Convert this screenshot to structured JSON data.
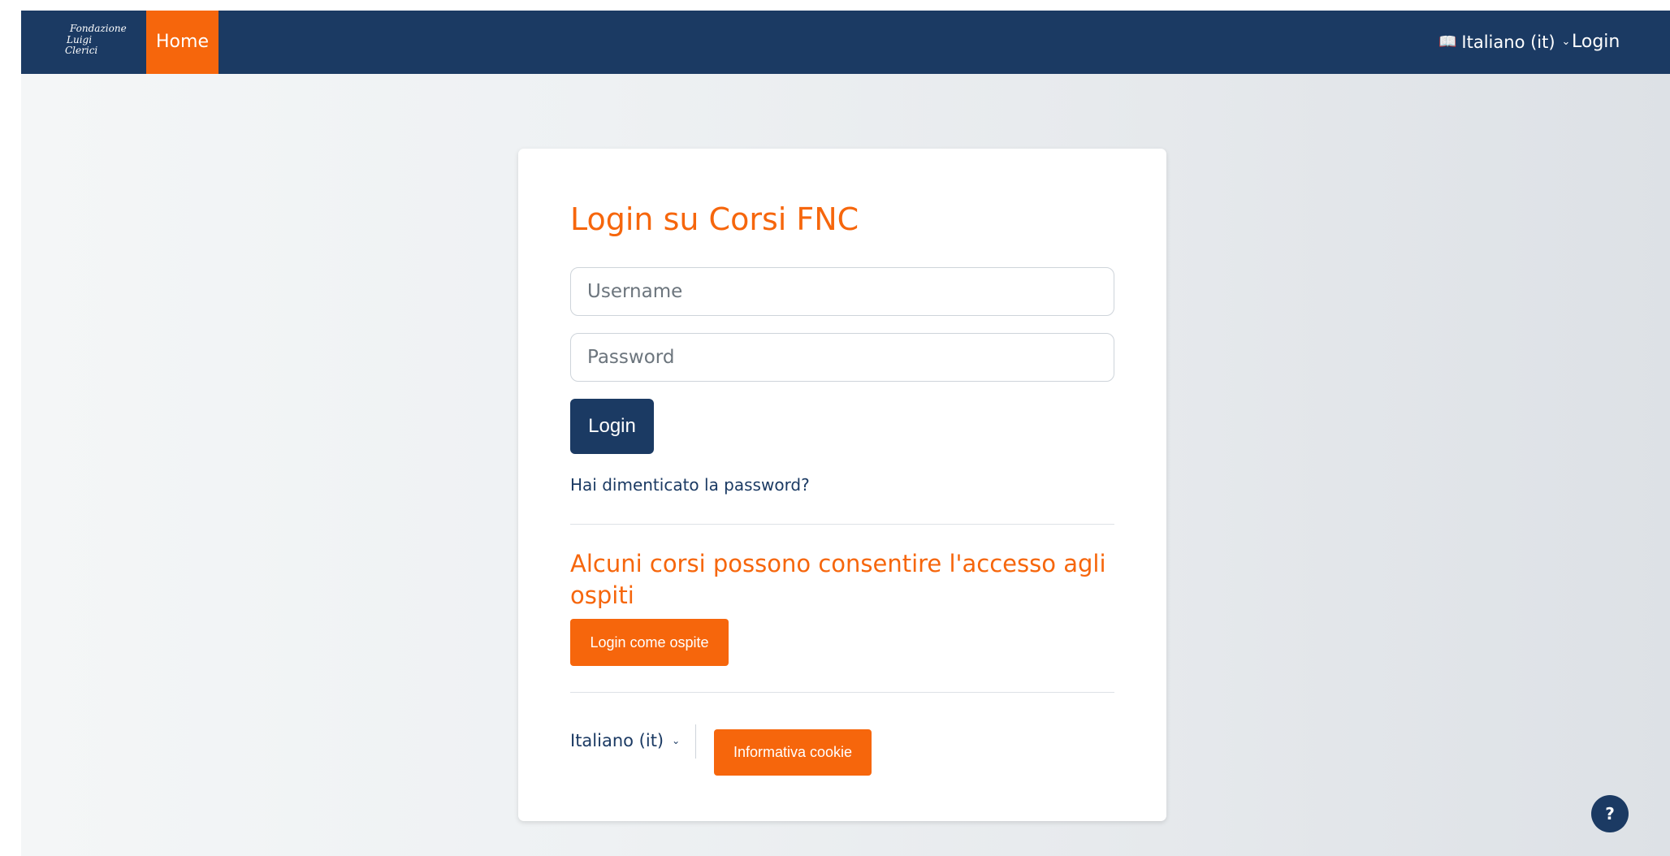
{
  "navbar": {
    "brand": {
      "line1": "Fondazione",
      "line2": "Luigi",
      "line3": "Clerici"
    },
    "home_label": "Home",
    "language": {
      "icon": "language-icon",
      "label": "Italiano (it)",
      "chevron": "chevron-down-icon"
    },
    "login_label": "Login"
  },
  "login_card": {
    "title": "Login su Corsi FNC",
    "username_placeholder": "Username",
    "password_placeholder": "Password",
    "login_button": "Login",
    "forgot_link": "Hai dimenticato la password?",
    "guest_heading": "Alcuni corsi possono consentire l'accesso agli ospiti",
    "guest_button": "Login come ospite",
    "footer_language": "Italiano (it)",
    "cookie_button": "Informativa cookie"
  },
  "help_button": {
    "label": "?",
    "icon": "question-icon"
  },
  "colors": {
    "navy": "#1b3a63",
    "orange": "#f6660c"
  }
}
